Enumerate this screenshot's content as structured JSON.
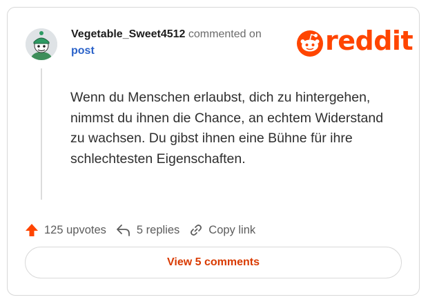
{
  "header": {
    "username": "Vegetable_Sweet4512",
    "action_text": "commented on",
    "post_link": "post"
  },
  "brand": {
    "wordmark": "reddit",
    "color": "#ff4500",
    "icon": "reddit-snoo-icon"
  },
  "comment": {
    "body": "Wenn du Menschen erlaubst, dich zu hintergehen, nimmst du ihnen die Chance, an echtem Widerstand zu wachsen. Du gibst ihnen eine Bühne für ihre schlechtesten Eigenschaften."
  },
  "actions": {
    "upvotes": "125 upvotes",
    "replies": "5 replies",
    "copy_link": "Copy link"
  },
  "footer": {
    "view_comments": "View 5 comments"
  },
  "colors": {
    "upvote": "#ff4500",
    "link": "#2a62c9",
    "view_button_text": "#d93a00"
  }
}
